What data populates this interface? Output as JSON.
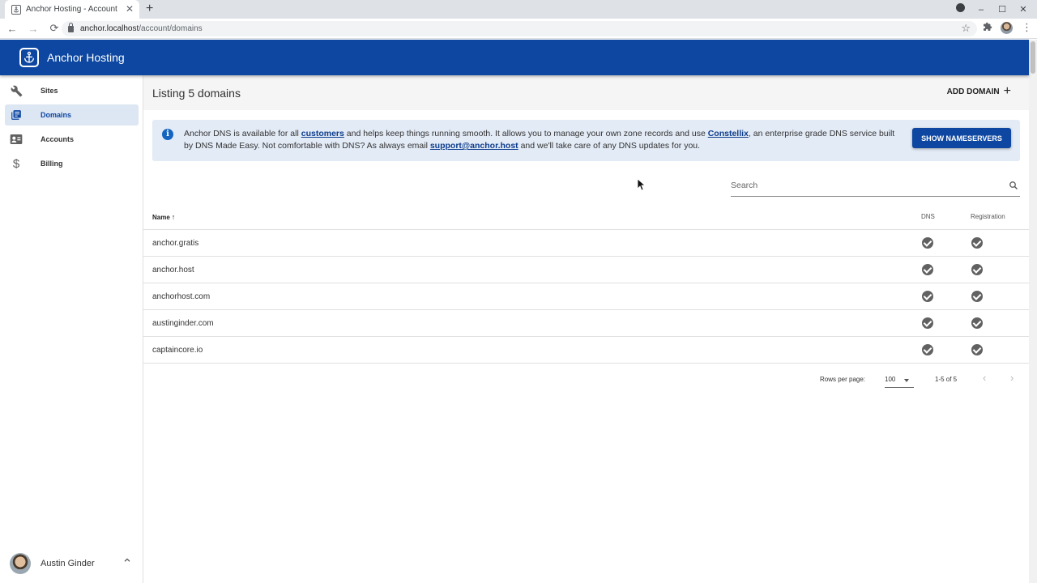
{
  "browser": {
    "tab_title": "Anchor Hosting - Account",
    "tab_close": "✕",
    "new_tab": "+",
    "url_host": "anchor.localhost",
    "url_path": "/account/domains",
    "back": "←",
    "forward": "→",
    "reload": "⟳",
    "star": "☆",
    "minimize": "–",
    "maximize": "☐",
    "close": "✕"
  },
  "app": {
    "title": "Anchor Hosting",
    "brand_color": "#0d47a1"
  },
  "sidebar": {
    "items": [
      {
        "label": "Sites",
        "icon": "wrench-icon",
        "active": false
      },
      {
        "label": "Domains",
        "icon": "list-icon",
        "active": true
      },
      {
        "label": "Accounts",
        "icon": "card-icon",
        "active": false
      },
      {
        "label": "Billing",
        "icon": "dollar-icon",
        "active": false
      }
    ],
    "user": {
      "name": "Austin Ginder"
    }
  },
  "main": {
    "title": "Listing 5 domains",
    "add_label": "ADD DOMAIN",
    "alert": {
      "t1": "Anchor DNS is available for all ",
      "link1": "customers",
      "t2": " and helps keep things running smooth. It allows you to manage your own zone records and use ",
      "link2": "Constellix",
      "t3": ", an enterprise grade DNS service built by DNS Made Easy. Not comfortable with DNS? As always email ",
      "link3": "support@anchor.host",
      "t4": " and we'll take care of any DNS updates for you.",
      "button": "SHOW NAMESERVERS"
    },
    "search": {
      "placeholder": "Search",
      "value": ""
    },
    "table": {
      "headers": {
        "name": "Name",
        "sort": "↑",
        "dns": "DNS",
        "registration": "Registration"
      },
      "rows": [
        {
          "name": "anchor.gratis",
          "dns": true,
          "registration": true
        },
        {
          "name": "anchor.host",
          "dns": true,
          "registration": true
        },
        {
          "name": "anchorhost.com",
          "dns": true,
          "registration": true
        },
        {
          "name": "austinginder.com",
          "dns": true,
          "registration": true
        },
        {
          "name": "captaincore.io",
          "dns": true,
          "registration": true
        }
      ]
    },
    "pagination": {
      "rows_per_page_label": "Rows per page:",
      "rows_per_page": "100",
      "range": "1-5 of 5",
      "prev": "‹",
      "next": "›"
    }
  }
}
